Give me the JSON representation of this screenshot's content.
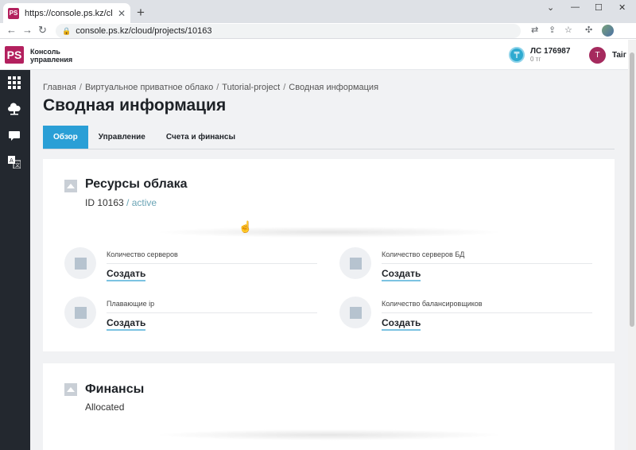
{
  "browser": {
    "tab_title": "https://console.ps.kz/cloud/proje",
    "tab_favicon": "PS",
    "address": "console.ps.kz/cloud/projects/10163"
  },
  "header": {
    "logo_mark": "PS",
    "logo_line1": "Консоль",
    "logo_line2": "управления",
    "account_icon": "₸",
    "account_number": "ЛС 176987",
    "account_balance": "0 тг",
    "user_initial": "T",
    "user_name": "Taiг"
  },
  "breadcrumb": {
    "items": [
      "Главная",
      "Виртуальное приватное облако",
      "Tutorial-project",
      "Сводная информация"
    ],
    "separator": "/"
  },
  "page": {
    "title": "Сводная информация"
  },
  "tabs": [
    {
      "label": "Обзор",
      "active": true
    },
    {
      "label": "Управление",
      "active": false
    },
    {
      "label": "Счета и финансы",
      "active": false
    }
  ],
  "resources": {
    "title": "Ресурсы облака",
    "id_text": "ID 10163",
    "status": "/ active",
    "items": [
      {
        "label": "Количество серверов",
        "action": "Создать"
      },
      {
        "label": "Количество серверов БД",
        "action": "Создать"
      },
      {
        "label": "Плавающие ip",
        "action": "Создать"
      },
      {
        "label": "Количество балансировщиков",
        "action": "Создать"
      }
    ]
  },
  "finance": {
    "title": "Финансы",
    "subtitle": "Allocated"
  },
  "colors": {
    "brand": "#b3205e",
    "accent": "#2a9fd6",
    "sidebar": "#23282f"
  }
}
